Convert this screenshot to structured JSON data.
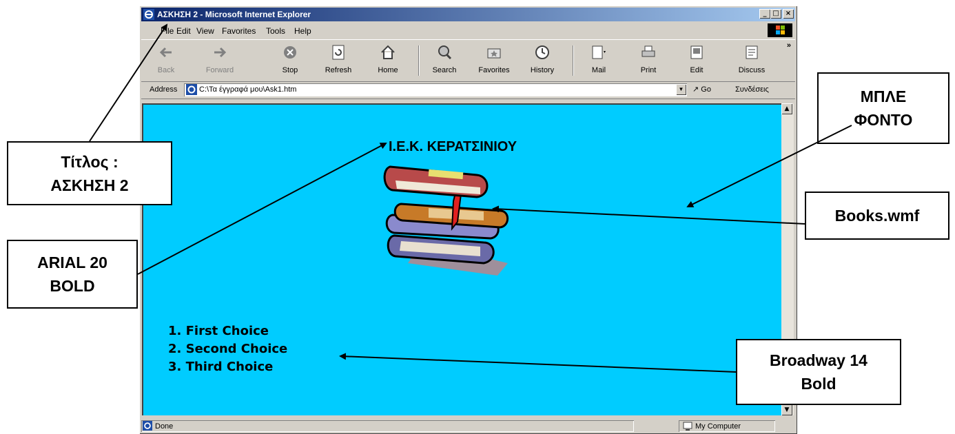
{
  "window": {
    "title": "ΑΣΚΗΣΗ 2 - Microsoft Internet Explorer",
    "controls": [
      "_",
      "□",
      "×"
    ]
  },
  "menu": [
    "File",
    "Edit",
    "View",
    "Favorites",
    "Tools",
    "Help"
  ],
  "toolbar": {
    "back": "Back",
    "forward": "Forward",
    "stop": "Stop",
    "refresh": "Refresh",
    "home": "Home",
    "search": "Search",
    "favorites": "Favorites",
    "history": "History",
    "mail": "Mail",
    "print": "Print",
    "edit": "Edit",
    "discuss": "Discuss",
    "more": "»"
  },
  "address": {
    "label": "Address",
    "value": "C:\\Τα έγγραφά μου\\Ask1.htm",
    "go": "Go",
    "links": "Συνδέσεις"
  },
  "page": {
    "heading": "Ι.Ε.Κ. ΚΕΡΑΤΣΙΝΙΟΥ",
    "choices": [
      "1. First Choice",
      "2. Second Choice",
      "3. Third Choice"
    ],
    "background_color": "#00ccff"
  },
  "status": {
    "text": "Done",
    "zone": "My Computer"
  },
  "callouts": {
    "title": "Τίτλος :\nΑΣΚΗΣΗ 2",
    "font_heading": "ARIAL 20\nBOLD",
    "background": "ΜΠΛΕ\nΦΟΝΤΟ",
    "image": "Books.wmf",
    "font_list": "Broadway 14\nBold"
  }
}
